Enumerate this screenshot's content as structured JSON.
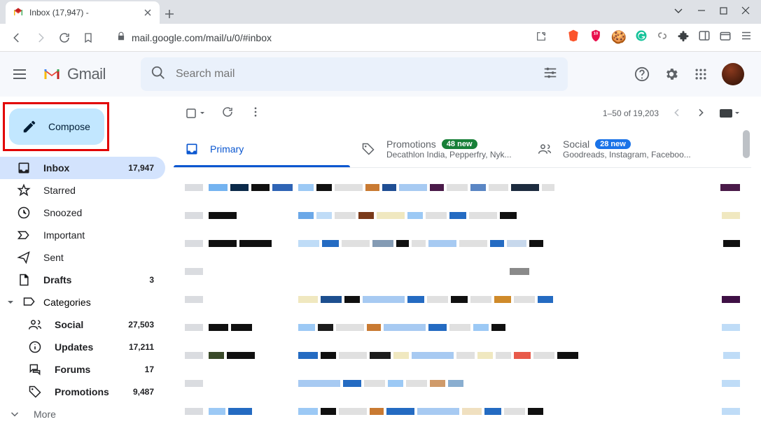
{
  "browser": {
    "tab_title": "Inbox (17,947) - ",
    "url": "mail.google.com/mail/u/0/#inbox"
  },
  "header": {
    "product": "Gmail",
    "search_placeholder": "Search mail"
  },
  "compose_label": "Compose",
  "nav": [
    {
      "label": "Inbox",
      "count": "17,947",
      "active": true
    },
    {
      "label": "Starred",
      "count": ""
    },
    {
      "label": "Snoozed",
      "count": ""
    },
    {
      "label": "Important",
      "count": ""
    },
    {
      "label": "Sent",
      "count": ""
    },
    {
      "label": "Drafts",
      "count": "3"
    },
    {
      "label": "Categories",
      "count": ""
    }
  ],
  "categories": [
    {
      "label": "Social",
      "count": "27,503"
    },
    {
      "label": "Updates",
      "count": "17,211"
    },
    {
      "label": "Forums",
      "count": "17"
    },
    {
      "label": "Promotions",
      "count": "9,487"
    }
  ],
  "more_label": "More",
  "toolbar": {
    "range": "1–50 of 19,203"
  },
  "tabs": {
    "primary": "Primary",
    "promotions": {
      "title": "Promotions",
      "badge": "48 new",
      "sub": "Decathlon India, Pepperfry, Nyk..."
    },
    "social": {
      "title": "Social",
      "badge": "28 new",
      "sub": "Goodreads, Instagram, Faceboo..."
    }
  }
}
